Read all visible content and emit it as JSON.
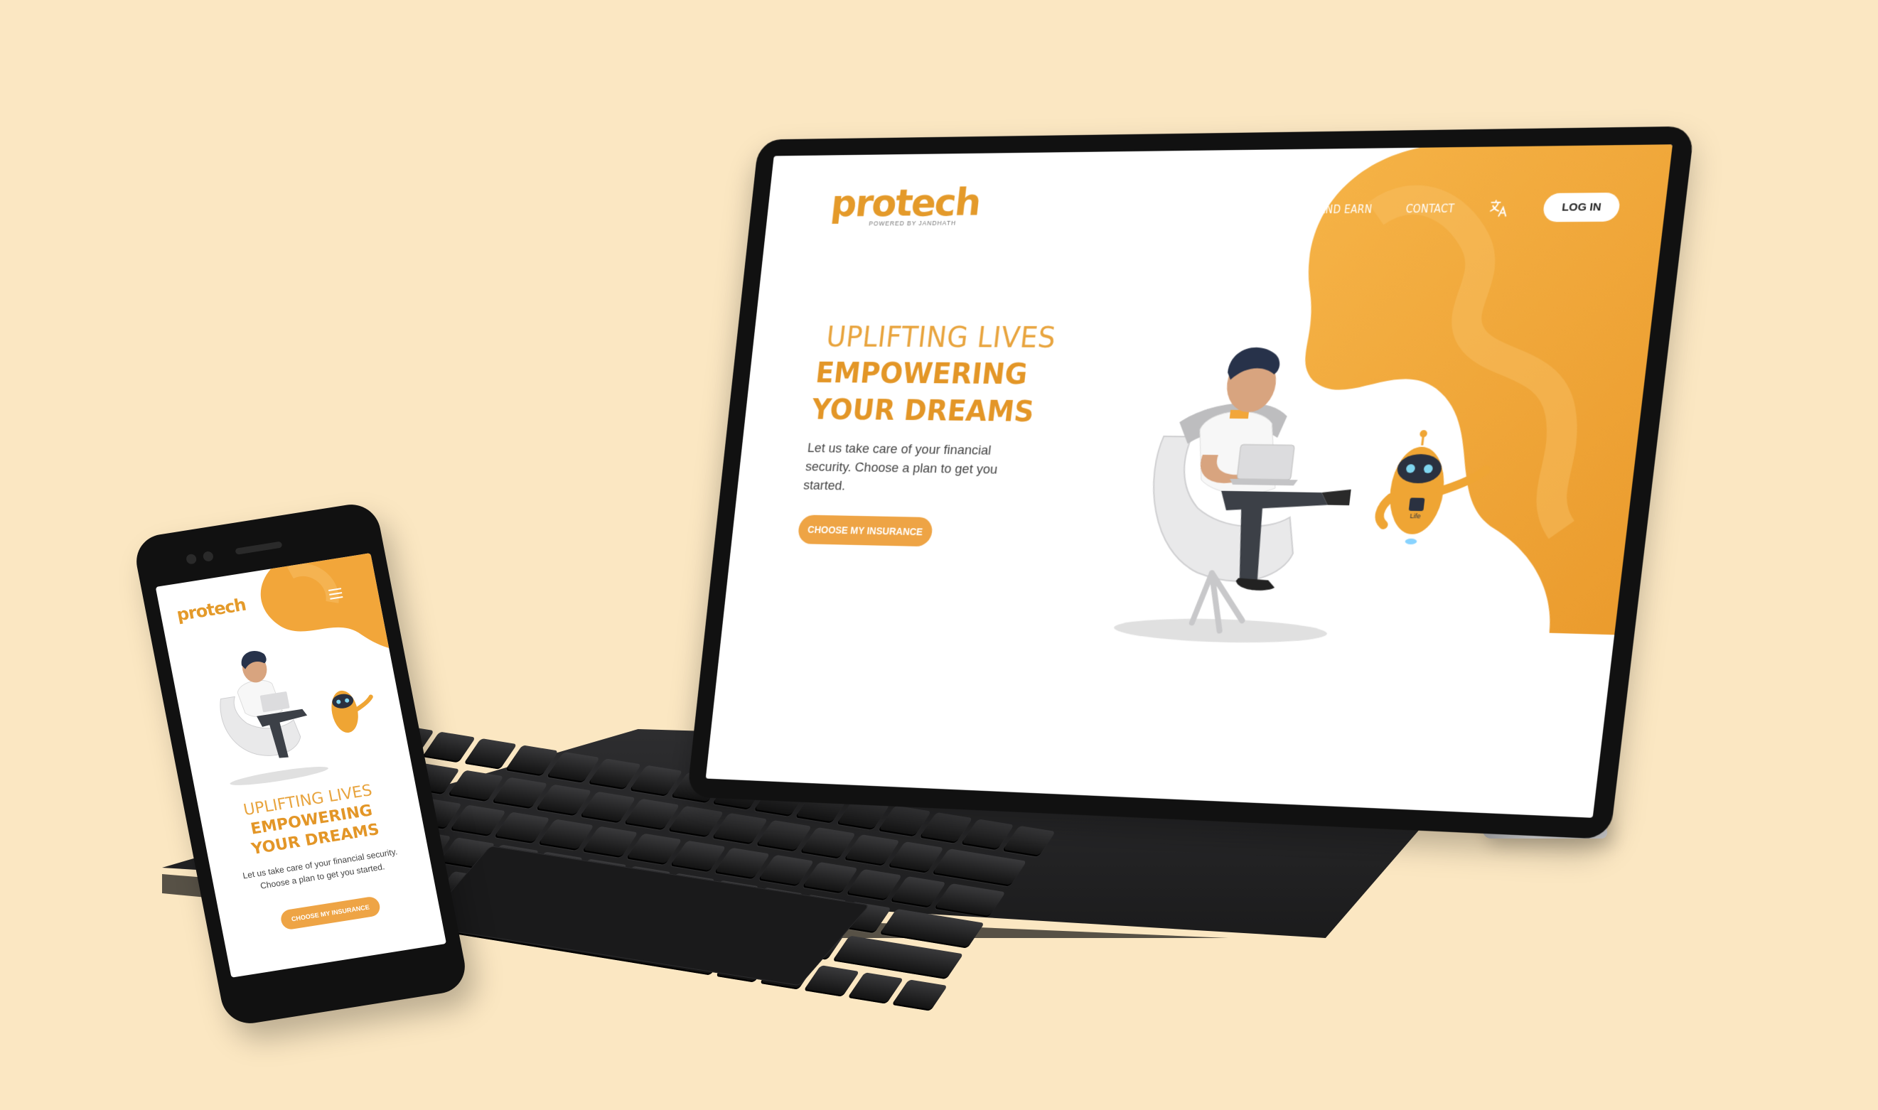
{
  "colors": {
    "background": "#fbe7c2",
    "accent": "#e39627",
    "accent_light": "#eea445",
    "blob": "#f3a83a"
  },
  "brand": {
    "logo_text": "protech",
    "logo_sub": "POWERED BY JANDHATH"
  },
  "nav": {
    "refer_label": "REFER AND EARN",
    "contact_label": "CONTACT",
    "translate_icon": "translate-icon",
    "login_label": "LOG IN"
  },
  "hero": {
    "line1": "UPLIFTING LIVES",
    "line2": "EMPOWERING",
    "line3": "YOUR DREAMS",
    "description": "Let us take care of your financial security. Choose a plan to get you started.",
    "cta_label": "CHOOSE MY INSURANCE"
  },
  "robot": {
    "badge_text": "Life"
  },
  "mobile": {
    "menu_icon": "hamburger-icon"
  }
}
